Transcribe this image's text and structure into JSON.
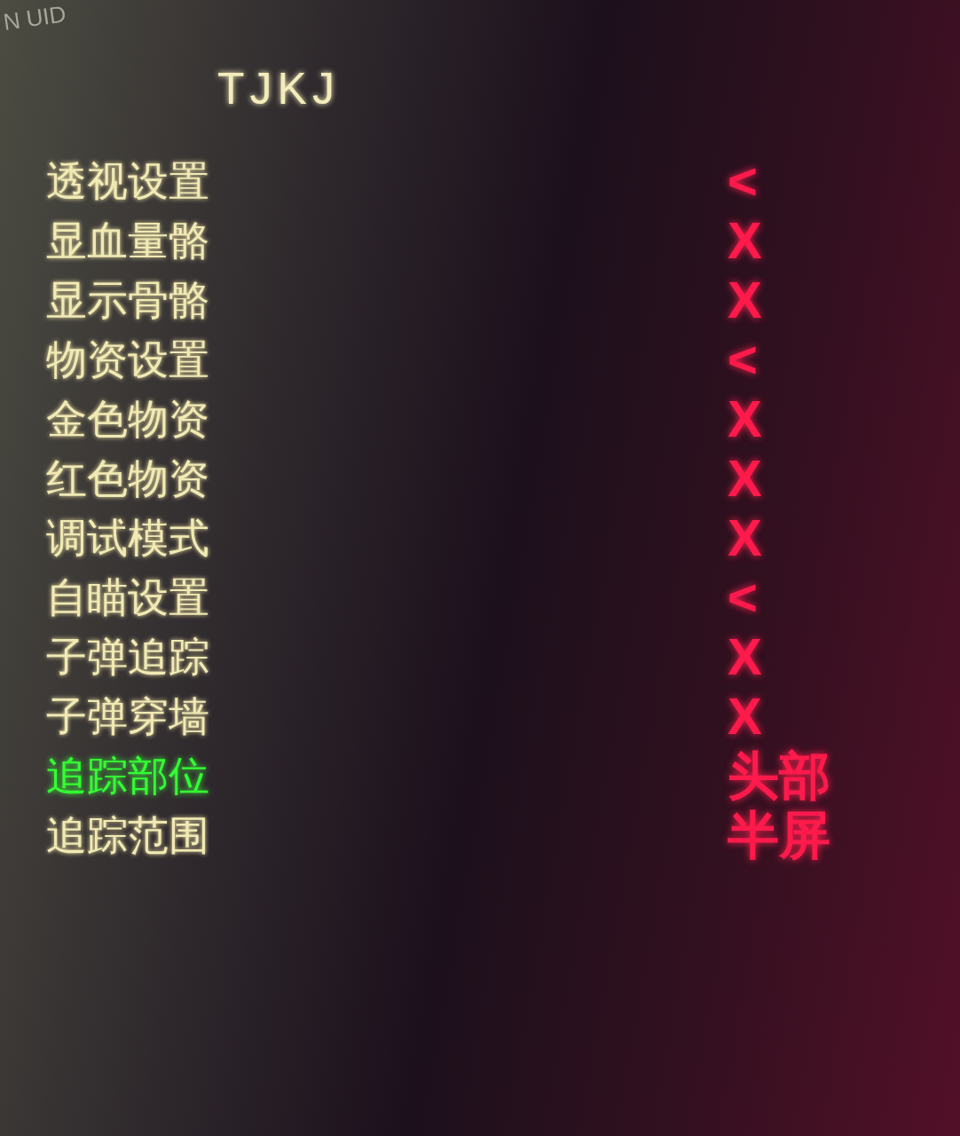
{
  "header_fragment": "N UID",
  "title": "TJKJ",
  "menu": [
    {
      "label": "透视设置",
      "value": "<",
      "selected": false
    },
    {
      "label": "显血量骼",
      "value": "X",
      "selected": false
    },
    {
      "label": "显示骨骼",
      "value": "X",
      "selected": false
    },
    {
      "label": "物资设置",
      "value": "<",
      "selected": false
    },
    {
      "label": "金色物资",
      "value": "X",
      "selected": false
    },
    {
      "label": "红色物资",
      "value": "X",
      "selected": false
    },
    {
      "label": "调试模式",
      "value": "X",
      "selected": false
    },
    {
      "label": "自瞄设置",
      "value": "<",
      "selected": false
    },
    {
      "label": "子弹追踪",
      "value": "X",
      "selected": false
    },
    {
      "label": "子弹穿墙",
      "value": "X",
      "selected": false
    },
    {
      "label": "追踪部位",
      "value": "头部",
      "selected": true
    },
    {
      "label": "追踪范围",
      "value": "半屏",
      "selected": false
    }
  ]
}
